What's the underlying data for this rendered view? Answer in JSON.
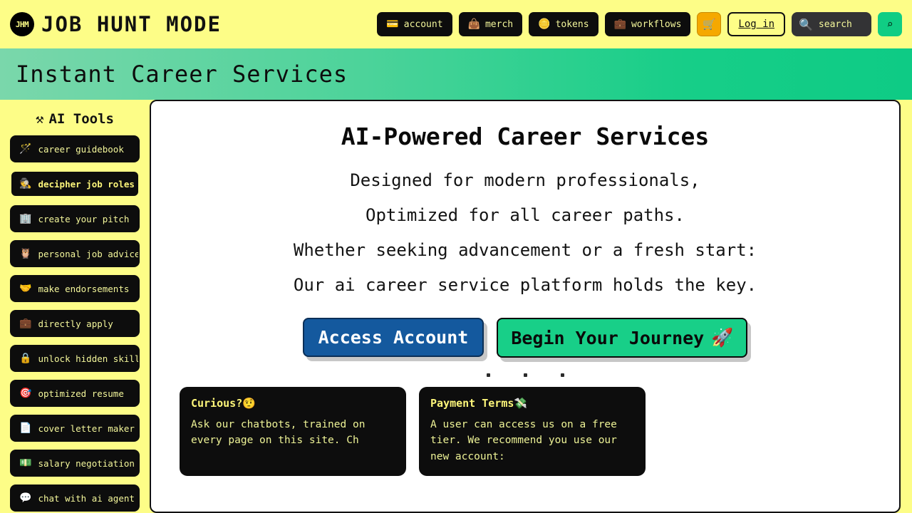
{
  "header": {
    "logo_text": "JHM",
    "brand_title": "JOB HUNT MODE",
    "nav_items": [
      {
        "label": "account",
        "icon": "💳",
        "icon_name": "credit-card-icon"
      },
      {
        "label": "merch",
        "icon": "👜",
        "icon_name": "shopping-bag-icon"
      },
      {
        "label": "tokens",
        "icon": "🪙",
        "icon_name": "coin-icon"
      },
      {
        "label": "workflows",
        "icon": "💼",
        "icon_name": "briefcase-icon"
      }
    ],
    "cart_icon": "🛒",
    "login_label": "Log in",
    "search_placeholder": "search",
    "search_value": "",
    "search_icon": "🔍",
    "search_submit_icon": "⌕"
  },
  "banner": {
    "title": "Instant Career Services"
  },
  "sidebar": {
    "heading": "AI Tools",
    "heading_icon": "⚒",
    "items": [
      {
        "label": "career guidebook",
        "icon": "🪄",
        "active": false
      },
      {
        "label": "decipher job roles",
        "icon": "🕵",
        "active": true
      },
      {
        "label": "create your pitch",
        "icon": "🏢",
        "active": false
      },
      {
        "label": "personal job advice",
        "icon": "🦉",
        "active": false
      },
      {
        "label": "make endorsements",
        "icon": "🤝",
        "active": false
      },
      {
        "label": "directly apply",
        "icon": "💼",
        "active": false
      },
      {
        "label": "unlock hidden skills",
        "icon": "🔒",
        "active": false
      },
      {
        "label": "optimized resume",
        "icon": "🎯",
        "active": false
      },
      {
        "label": "cover letter maker",
        "icon": "📄",
        "active": false
      },
      {
        "label": "salary negotiation",
        "icon": "💵",
        "active": false
      },
      {
        "label": "chat with ai agent",
        "icon": "💬",
        "active": false
      }
    ]
  },
  "main": {
    "title": "AI-Powered Career Services",
    "lines": [
      "Designed for modern professionals,",
      "Optimized for all career paths.",
      "Whether seeking advancement or a fresh start:",
      "Our ai career service platform holds the key."
    ],
    "primary_cta": "Access Account",
    "secondary_cta": "Begin Your Journey",
    "secondary_cta_icon": "🚀",
    "dots": 3,
    "cards": [
      {
        "title": "Curious?",
        "title_icon": "🤨",
        "body": "Ask our chatbots, trained on every page on this site. Ch"
      },
      {
        "title": "Payment Terms",
        "title_icon": "💸",
        "body": "A user can access us on a free tier. We recommend you use our new account:"
      }
    ]
  }
}
